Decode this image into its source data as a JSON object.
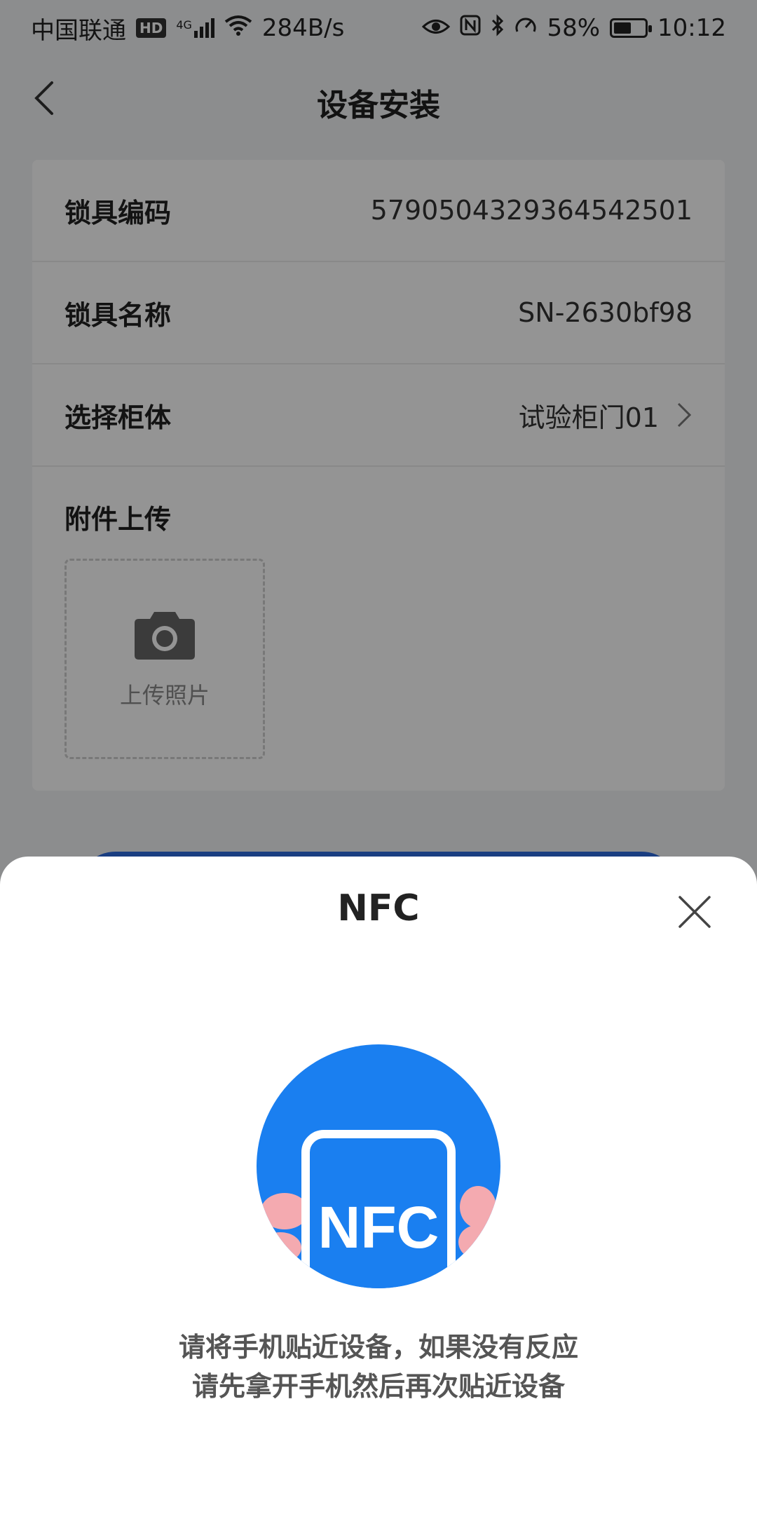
{
  "status_bar": {
    "carrier": "中国联通",
    "hd": "HD",
    "network": "4G",
    "speed": "284B/s",
    "battery": "58%",
    "battery_level": 0.58,
    "time": "10:12"
  },
  "header": {
    "title": "设备安装"
  },
  "form": {
    "rows": [
      {
        "label": "锁具编码",
        "value": "579050432936454250​1"
      },
      {
        "label": "锁具名称",
        "value": "SN-2630bf98"
      },
      {
        "label": "选择柜体",
        "value": "试验柜门01"
      }
    ],
    "attachment_label": "附件上传",
    "upload_label": "上传照片"
  },
  "nfc_sheet": {
    "title": "NFC",
    "illustration_text": "NFC",
    "hint_line1": "请将手机贴近设备，如果没有反应",
    "hint_line2": "请先拿开手机然后再次贴近设备"
  },
  "colors": {
    "primary": "#2d6cdf",
    "nfc_blue": "#1a7ff0"
  }
}
